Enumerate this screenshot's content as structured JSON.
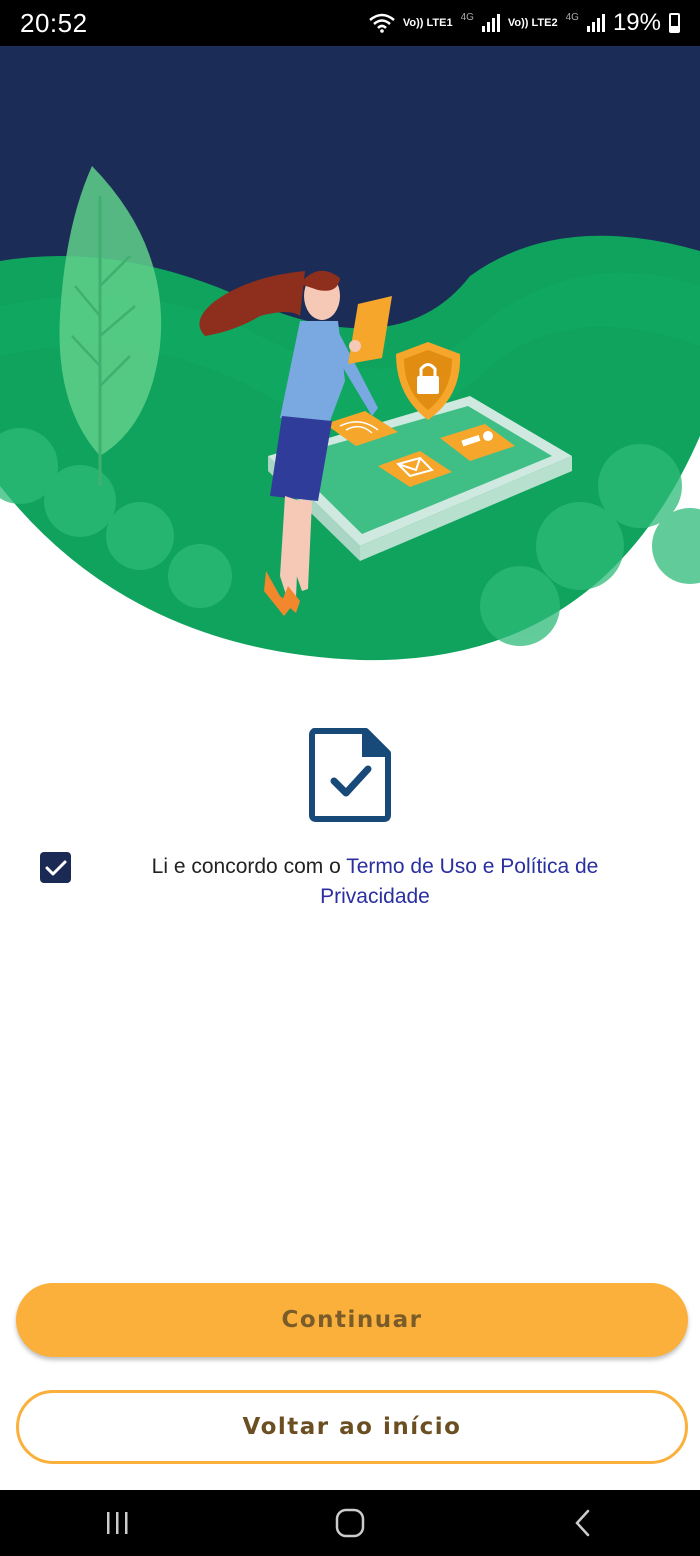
{
  "status_bar": {
    "time": "20:52",
    "sim1": "Vo)) LTE1",
    "sim2": "Vo)) LTE2",
    "network": "4G",
    "battery": "19%"
  },
  "illustration": {
    "description_icons": [
      "leaf-icon",
      "shield-lock-icon",
      "fingerprint-icon",
      "mail-icon",
      "id-card-icon"
    ]
  },
  "terms": {
    "checked": true,
    "prefix": "Li e concordo com o ",
    "link": "Termo de Uso e Política de Privacidade"
  },
  "buttons": {
    "continue": "Continuar",
    "back": "Voltar ao início"
  },
  "colors": {
    "navy": "#1b2a55",
    "green": "#0fa35e",
    "accent": "#fbb03b",
    "link": "#2a2fa0"
  }
}
